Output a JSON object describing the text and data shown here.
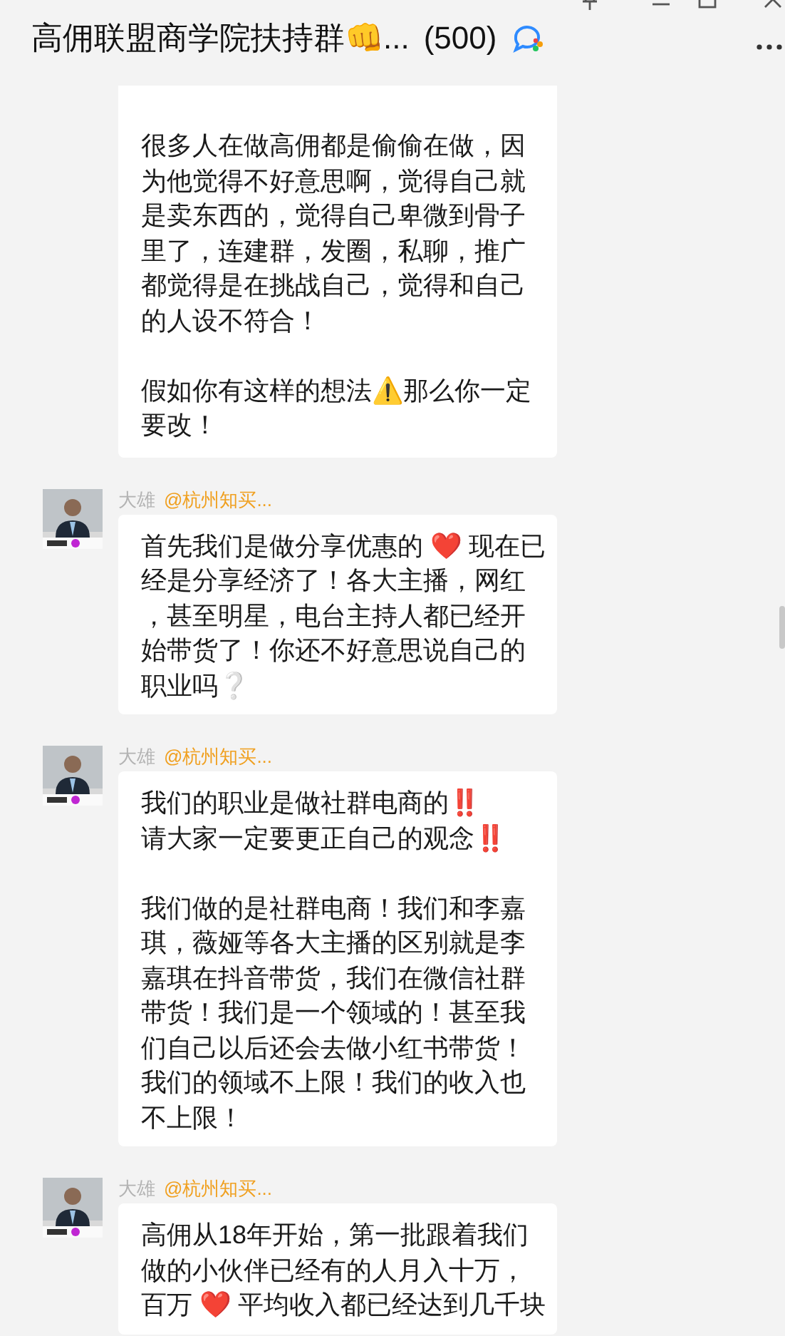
{
  "window": {
    "title": "高佣联盟商学院扶持群👊...",
    "member_count": "(500)"
  },
  "messages": [
    {
      "paragraphs": [
        [
          "很多人在做高佣都是偷偷在做，因为他觉得不好意思啊，觉得自己就是卖东西的，觉得自己卑微到骨子里了，连建群，发圈，私聊，推广都觉得是在挑战自己，觉得和自己的人设不符合！"
        ],
        [
          "假如你有这样的想法⚠️那么你一定要改！"
        ]
      ]
    },
    {
      "sender": "大雄",
      "mention": "@杭州知买...",
      "paragraphs": [
        [
          "首先我们是做分享优惠的 ❤️ 现在已经是分享经济了！各大主播，网红，甚至明星，电台主持人都已经开始带货了！你还不好意思说自己的职业吗❔"
        ]
      ]
    },
    {
      "sender": "大雄",
      "mention": "@杭州知买...",
      "paragraphs": [
        [
          "我们的职业是做社群电商的‼️",
          "请大家一定要更正自己的观念‼️"
        ],
        [
          "我们做的是社群电商！我们和李嘉琪，薇娅等各大主播的区别就是李嘉琪在抖音带货，我们在微信社群带货！我们是一个领域的！甚至我们自己以后还会去做小红书带货！我们的领域不上限！我们的收入也不上限！"
        ]
      ]
    },
    {
      "sender": "大雄",
      "mention": "@杭州知买...",
      "paragraphs": [
        [
          "高佣从18年开始，第一批跟着我们做的小伙伴已经有的人月入十万，百万 ❤️ 平均收入都已经达到几千块"
        ]
      ]
    }
  ]
}
